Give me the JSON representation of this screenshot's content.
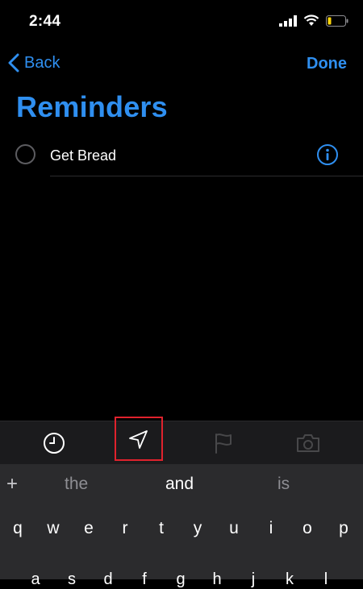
{
  "status_bar": {
    "time": "2:44"
  },
  "nav": {
    "back_label": "Back",
    "done_label": "Done"
  },
  "page_title": "Reminders",
  "reminders": [
    {
      "text": "Get Bread"
    }
  ],
  "toolbar": {
    "items": [
      "clock-icon",
      "location-arrow-icon",
      "flag-icon",
      "camera-icon"
    ],
    "highlighted": "location-arrow-icon"
  },
  "keyboard": {
    "predictions": [
      "the",
      "and",
      "is"
    ],
    "row1": [
      "q",
      "w",
      "e",
      "r",
      "t",
      "y",
      "u",
      "i",
      "o",
      "p"
    ],
    "row2": [
      "a",
      "s",
      "d",
      "f",
      "g",
      "h",
      "j",
      "k",
      "l"
    ]
  },
  "colors": {
    "accent": "#2f8ff0",
    "highlight_box": "#e0222d",
    "toolbar_bg": "#1b1b1d",
    "keyboard_bg": "#2b2b2d"
  }
}
